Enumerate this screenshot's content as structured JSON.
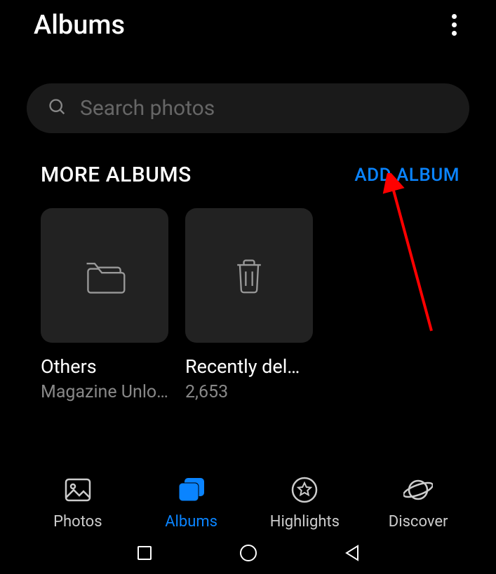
{
  "header": {
    "title": "Albums"
  },
  "search": {
    "placeholder": "Search photos"
  },
  "section": {
    "title": "MORE ALBUMS",
    "add_label": "ADD ALBUM"
  },
  "albums": [
    {
      "name": "Others",
      "subtitle": "Magazine Unlo…",
      "icon": "folder"
    },
    {
      "name": "Recently del…",
      "subtitle": "2,653",
      "icon": "trash"
    }
  ],
  "bottom_nav": [
    {
      "label": "Photos",
      "icon": "photo",
      "active": false
    },
    {
      "label": "Albums",
      "icon": "albums",
      "active": true
    },
    {
      "label": "Highlights",
      "icon": "star",
      "active": false
    },
    {
      "label": "Discover",
      "icon": "planet",
      "active": false
    }
  ]
}
